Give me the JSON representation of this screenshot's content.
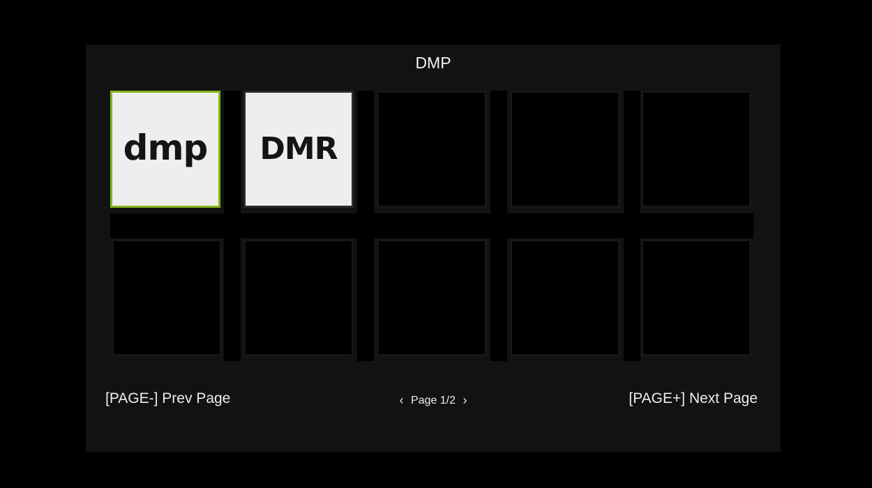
{
  "window": {
    "title": "DMP"
  },
  "grid": {
    "tiles": [
      {
        "logo": "dmp",
        "selected": true
      },
      {
        "logo": "DMR",
        "selected": false
      },
      {
        "logo": "",
        "selected": false
      },
      {
        "logo": "",
        "selected": false
      },
      {
        "logo": "",
        "selected": false
      },
      {
        "logo": "",
        "selected": false
      },
      {
        "logo": "",
        "selected": false
      },
      {
        "logo": "",
        "selected": false
      },
      {
        "logo": "",
        "selected": false
      },
      {
        "logo": "",
        "selected": false
      }
    ]
  },
  "footer": {
    "prev_label": "[PAGE-] Prev Page",
    "next_label": "[PAGE+] Next Page",
    "page_text": "Page 1/2",
    "prev_icon": "chevron-left-icon",
    "next_icon": "chevron-right-icon"
  },
  "colors": {
    "background": "#000000",
    "panel": "#121212",
    "selection": "#85b81c",
    "tile_fill": "#eeeeee"
  }
}
